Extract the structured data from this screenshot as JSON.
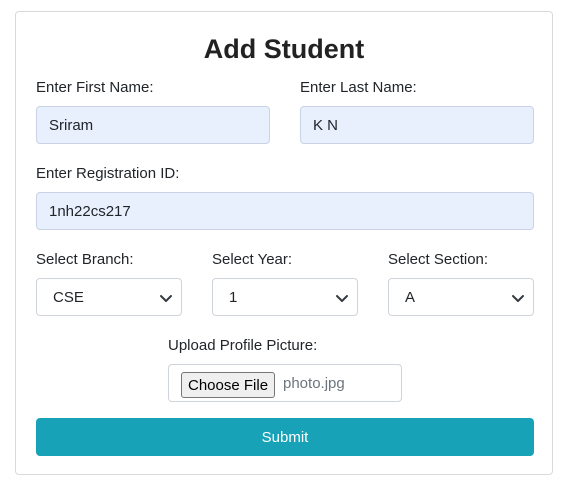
{
  "form": {
    "title": "Add Student",
    "first_name": {
      "label": "Enter First Name:",
      "value": "Sriram"
    },
    "last_name": {
      "label": "Enter Last Name:",
      "value": "K N"
    },
    "registration_id": {
      "label": "Enter Registration ID:",
      "value": "1nh22cs217"
    },
    "branch": {
      "label": "Select Branch:",
      "selected": "CSE"
    },
    "year": {
      "label": "Select Year:",
      "selected": "1"
    },
    "section": {
      "label": "Select Section:",
      "selected": "A"
    },
    "profile_picture": {
      "label": "Upload Profile Picture:",
      "button_label": "Choose File",
      "file_name": "photo.jpg"
    },
    "submit_label": "Submit"
  },
  "icons": {
    "select_arrow": "chevron-down-icon"
  },
  "colors": {
    "submit_button": "#17a2b8",
    "autofill_background": "#e8f0fe",
    "border": "#ced4da"
  }
}
